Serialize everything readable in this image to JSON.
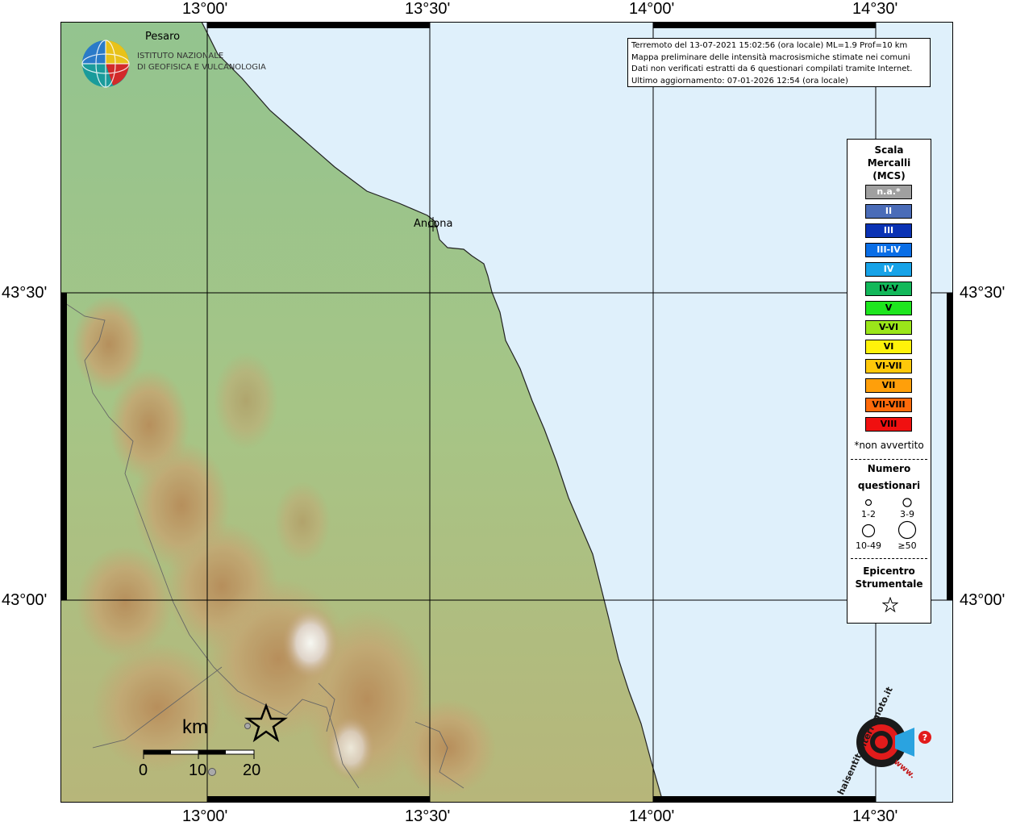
{
  "axes": {
    "top_ticks": [
      "13°00'",
      "13°30'",
      "14°00'",
      "14°30'"
    ],
    "bottom_ticks": [
      "13°00'",
      "13°30'",
      "14°00'",
      "14°30'"
    ],
    "left_ticks": [
      "43°30'",
      "43°00'"
    ],
    "right_ticks": [
      "43°30'",
      "43°00'"
    ]
  },
  "logo": {
    "line1": "ISTITUTO NAZIONALE",
    "line2": "DI GEOFISICA E VULCANOLOGIA"
  },
  "cities": [
    {
      "name": "Pesaro"
    },
    {
      "name": "Ancona"
    }
  ],
  "info": {
    "line1": "Terremoto del 13-07-2021 15:02:56 (ora locale) ML=1.9 Prof=10 km",
    "line2": "Mappa preliminare delle intensità macrosismiche stimate nei comuni",
    "line3": "Dati non verificati estratti da 6 questionari compilati tramite Internet.",
    "line4": "Ultimo aggiornamento: 07-01-2026 12:54 (ora locale)"
  },
  "legend": {
    "title1": "Scala",
    "title2": "Mercalli",
    "title3": "(MCS)",
    "scale": [
      {
        "label": "n.a.*",
        "color": "#a0a0a0",
        "text": "#ffffff"
      },
      {
        "label": "II",
        "color": "#4a6cb8",
        "text": "#ffffff"
      },
      {
        "label": "III",
        "color": "#0a32b4",
        "text": "#ffffff"
      },
      {
        "label": "III-IV",
        "color": "#0a6ee6",
        "text": "#ffffff"
      },
      {
        "label": "IV",
        "color": "#17a3e8",
        "text": "#ffffff"
      },
      {
        "label": "IV-V",
        "color": "#13b85a",
        "text": "#000000"
      },
      {
        "label": "V",
        "color": "#1ee61e",
        "text": "#000000"
      },
      {
        "label": "V-VI",
        "color": "#9be61a",
        "text": "#000000"
      },
      {
        "label": "VI",
        "color": "#fff20a",
        "text": "#000000"
      },
      {
        "label": "VI-VII",
        "color": "#ffc80a",
        "text": "#000000"
      },
      {
        "label": "VII",
        "color": "#ff9f0a",
        "text": "#000000"
      },
      {
        "label": "VII-VIII",
        "color": "#ff6a0a",
        "text": "#000000"
      },
      {
        "label": "VIII",
        "color": "#f01010",
        "text": "#000000"
      }
    ],
    "not_felt_note": "*non avvertito",
    "count_title1": "Numero",
    "count_title2": "questionari",
    "counts": [
      "1-2",
      "3-9",
      "10-49",
      "≥50"
    ],
    "epicenter_title1": "Epicentro",
    "epicenter_title2": "Strumentale"
  },
  "scale_bar": {
    "unit": "km",
    "labels": [
      "0",
      "10",
      "20"
    ]
  },
  "badge": {
    "text": "haisentitoilterremoto.it",
    "prefix": "www."
  },
  "colors": {
    "sea": "#dff0fb",
    "land_low": "#8ec48a",
    "land_hill": "#b8c88a",
    "land_mountain": "#b08858",
    "grid": "#000000"
  }
}
